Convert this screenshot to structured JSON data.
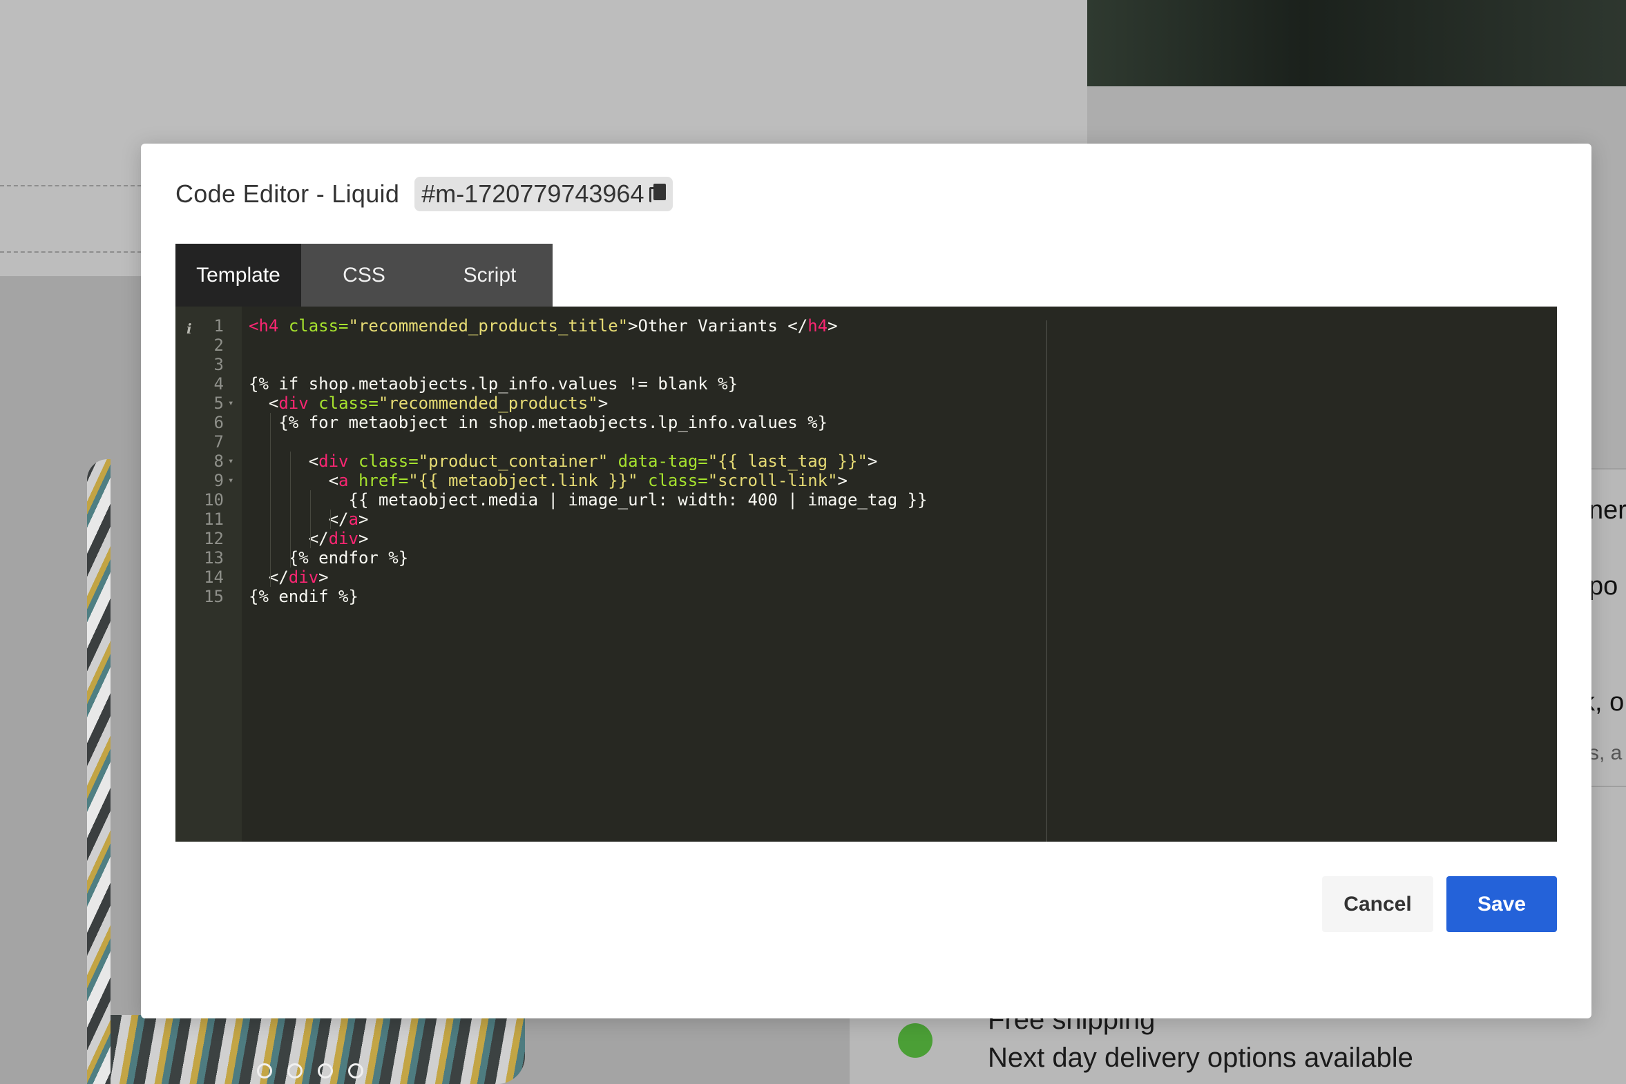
{
  "background": {
    "right_snippets": [
      "ner",
      "po",
      "k, o",
      "s, a"
    ],
    "shipping": {
      "title": "Free shipping",
      "subtitle": "Next day delivery options available"
    }
  },
  "modal": {
    "title": "Code Editor - Liquid",
    "element_id": "#m-1720779743964",
    "tabs": [
      {
        "label": "Template",
        "active": true
      },
      {
        "label": "CSS",
        "active": false
      },
      {
        "label": "Script",
        "active": false
      }
    ],
    "editor": {
      "lines": [
        {
          "n": "1",
          "tokens": [
            [
              "tag",
              "<"
            ],
            [
              "tag",
              "h4"
            ],
            [
              "txt",
              " "
            ],
            [
              "attr",
              "class="
            ],
            [
              "str",
              "\"recommended_products_title\""
            ],
            [
              "txt",
              ">Other Variants </"
            ],
            [
              "tag",
              "h4"
            ],
            [
              "txt",
              ">"
            ]
          ]
        },
        {
          "n": "2",
          "tokens": []
        },
        {
          "n": "3",
          "tokens": []
        },
        {
          "n": "4",
          "tokens": [
            [
              "txt",
              "{% if shop.metaobjects.lp_info.values != blank %}"
            ]
          ]
        },
        {
          "n": "5",
          "fold": true,
          "tokens": [
            [
              "txt",
              "  <"
            ],
            [
              "tag",
              "div"
            ],
            [
              "txt",
              " "
            ],
            [
              "attr",
              "class="
            ],
            [
              "str",
              "\"recommended_products\""
            ],
            [
              "txt",
              ">"
            ]
          ]
        },
        {
          "n": "6",
          "tokens": [
            [
              "txt",
              "   {% for metaobject in shop.metaobjects.lp_info.values %}"
            ]
          ]
        },
        {
          "n": "7",
          "tokens": []
        },
        {
          "n": "8",
          "fold": true,
          "tokens": [
            [
              "txt",
              "      <"
            ],
            [
              "tag",
              "div"
            ],
            [
              "txt",
              " "
            ],
            [
              "attr",
              "class="
            ],
            [
              "str",
              "\"product_container\""
            ],
            [
              "txt",
              " "
            ],
            [
              "attr",
              "data-tag="
            ],
            [
              "str",
              "\"{{ last_tag }}\""
            ],
            [
              "txt",
              ">"
            ]
          ]
        },
        {
          "n": "9",
          "fold": true,
          "tokens": [
            [
              "txt",
              "        <"
            ],
            [
              "tag",
              "a"
            ],
            [
              "txt",
              " "
            ],
            [
              "attr",
              "href="
            ],
            [
              "str",
              "\"{{ metaobject.link }}\""
            ],
            [
              "txt",
              " "
            ],
            [
              "attr",
              "class="
            ],
            [
              "str",
              "\"scroll-link\""
            ],
            [
              "txt",
              ">"
            ]
          ]
        },
        {
          "n": "10",
          "tokens": [
            [
              "txt",
              "          {{ metaobject.media | image_url: width: 400 | image_tag }}"
            ]
          ]
        },
        {
          "n": "11",
          "tokens": [
            [
              "txt",
              "        </"
            ],
            [
              "tag",
              "a"
            ],
            [
              "txt",
              ">"
            ]
          ]
        },
        {
          "n": "12",
          "tokens": [
            [
              "txt",
              "      </"
            ],
            [
              "tag",
              "div"
            ],
            [
              "txt",
              ">"
            ]
          ]
        },
        {
          "n": "13",
          "tokens": [
            [
              "txt",
              "    {% endfor %}"
            ]
          ]
        },
        {
          "n": "14",
          "tokens": [
            [
              "txt",
              "  </"
            ],
            [
              "tag",
              "div"
            ],
            [
              "txt",
              ">"
            ]
          ]
        },
        {
          "n": "15",
          "tokens": [
            [
              "txt",
              "{% endif %}"
            ]
          ]
        }
      ]
    },
    "buttons": {
      "cancel_label": "Cancel",
      "save_label": "Save"
    }
  },
  "colors": {
    "save_button": "#2462d9",
    "editor_background": "#272822",
    "tag": "#f92672",
    "attribute": "#a6e22e",
    "string": "#e6db74"
  },
  "icons": [
    "copy-icon",
    "info-icon",
    "fold-arrow-icon"
  ]
}
